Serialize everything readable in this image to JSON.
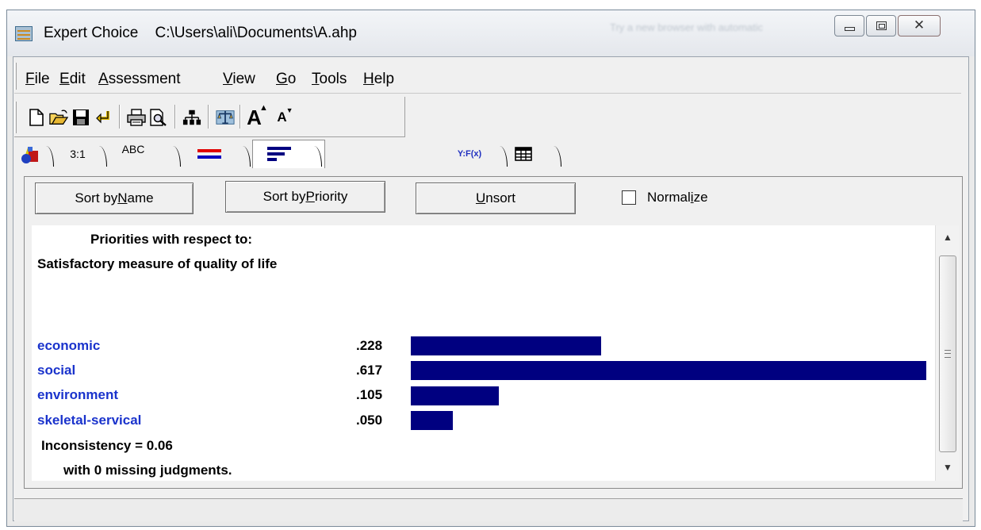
{
  "window": {
    "app_name": "Expert Choice",
    "file_path": "C:\\Users\\ali\\Documents\\A.ahp",
    "ghost_text": "Try a new browser with automatic"
  },
  "menu": {
    "items": [
      {
        "key": "F",
        "rest": "ile"
      },
      {
        "key": "E",
        "rest": "dit"
      },
      {
        "key": "A",
        "rest": "ssessment"
      },
      {
        "key": "V",
        "rest": "iew"
      },
      {
        "key": "G",
        "rest": "o"
      },
      {
        "key": "T",
        "rest": "ools"
      },
      {
        "key": "H",
        "rest": "elp"
      }
    ]
  },
  "tabs": {
    "ratio": "3:1",
    "abc": "ABC",
    "formula": "Y:F(x)"
  },
  "buttons": {
    "sort_name_pre": "Sort by ",
    "sort_name_key": "N",
    "sort_name_post": "ame",
    "sort_priority_pre": "Sort by ",
    "sort_priority_key": "P",
    "sort_priority_post": "riority",
    "unsort_key": "U",
    "unsort_post": "nsort",
    "normalize_pre": "Normal",
    "normalize_key": "i",
    "normalize_post": "ze"
  },
  "normalize_checked": false,
  "report": {
    "heading_line1": "Priorities with respect to:",
    "heading_line2": "Satisfactory measure of quality of life",
    "items": [
      {
        "name": "economic",
        "value_label": ".228",
        "value": 0.228
      },
      {
        "name": "social",
        "value_label": ".617",
        "value": 0.617
      },
      {
        "name": "environment",
        "value_label": ".105",
        "value": 0.105
      },
      {
        "name": "skeletal-servical",
        "value_label": ".050",
        "value": 0.05
      }
    ],
    "inconsistency": "Inconsistency = 0.06",
    "missing": "with 0  missing judgments."
  },
  "colors": {
    "bar": "#000080",
    "item_name": "#1a33cc"
  }
}
